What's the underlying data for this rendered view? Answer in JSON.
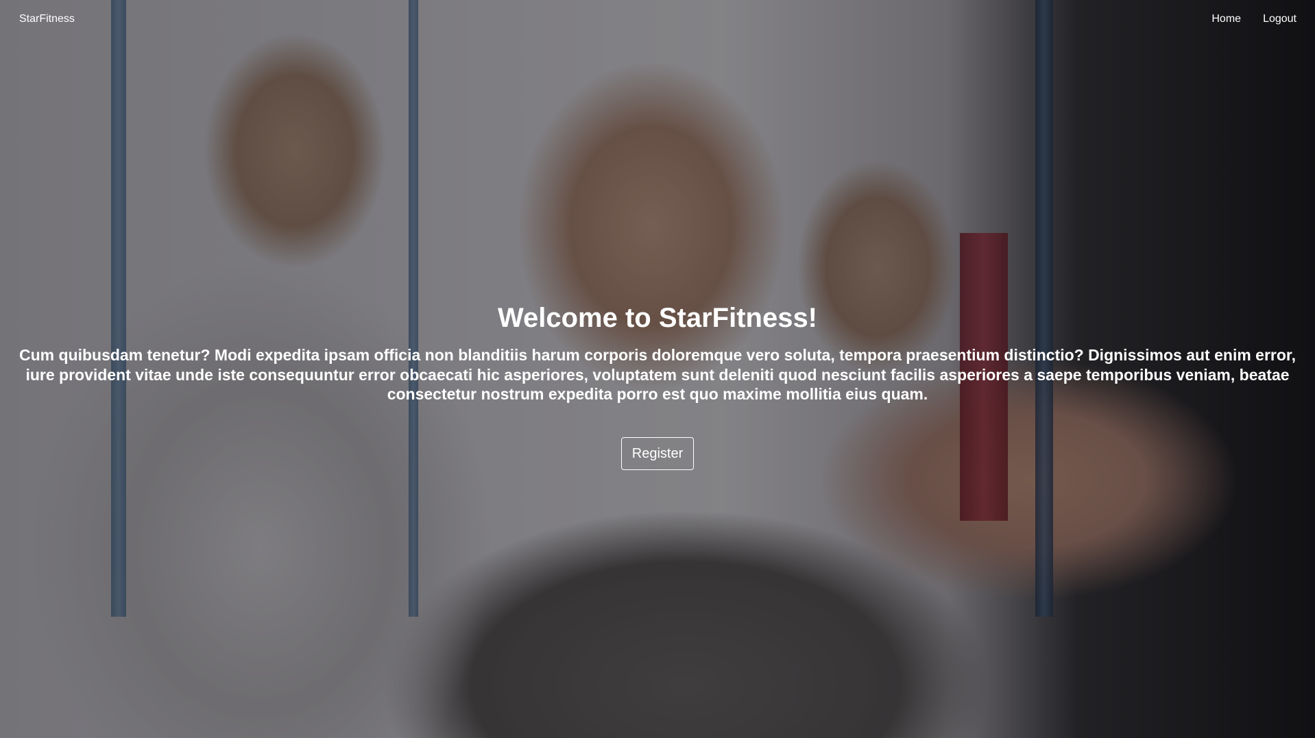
{
  "nav": {
    "brand": "StarFitness",
    "links": [
      "Home",
      "Logout"
    ]
  },
  "hero": {
    "title": "Welcome to StarFitness!",
    "description": "Cum quibusdam tenetur? Modi expedita ipsam officia non blanditiis harum corporis doloremque vero soluta, tempora praesentium distinctio? Dignissimos aut enim error, iure provident vitae unde iste consequuntur error obcaecati hic asperiores, voluptatem sunt deleniti quod nesciunt facilis asperiores a saepe temporibus veniam, beatae consectetur nostrum expedita porro est quo maxime mollitia eius quam.",
    "cta": "Register"
  }
}
